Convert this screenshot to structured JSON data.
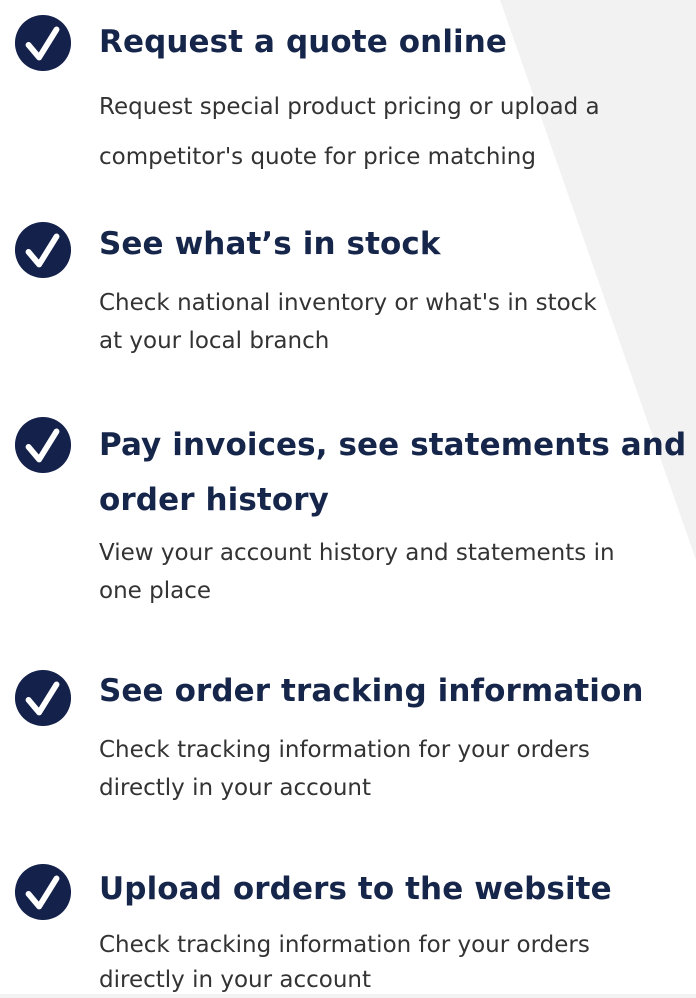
{
  "colors": {
    "icon_fill": "#14214a",
    "icon_check": "#ffffff",
    "title_text": "#16264a",
    "body_text": "#333333"
  },
  "icon": "check-circle-icon",
  "features": [
    {
      "title_lines": [
        "Request a quote online"
      ],
      "desc_lines": [
        "Request special product pricing or upload a",
        "competitor's quote for price matching"
      ]
    },
    {
      "title_lines": [
        "See what’s in  stock"
      ],
      "desc_lines": [
        "Check national inventory or what's in stock",
        "at your local  branch"
      ]
    },
    {
      "title_lines": [
        "Pay invoices, see statements and",
        "order  history"
      ],
      "desc_lines": [
        "View your account history and statements in",
        "one  place"
      ]
    },
    {
      "title_lines": [
        "See order tracking  information"
      ],
      "desc_lines": [
        "Check tracking information for your orders",
        "directly in your  account"
      ]
    },
    {
      "title_lines": [
        "Upload orders to the website"
      ],
      "desc_lines": [
        "Check tracking information for your orders",
        "directly in your  account"
      ]
    }
  ]
}
